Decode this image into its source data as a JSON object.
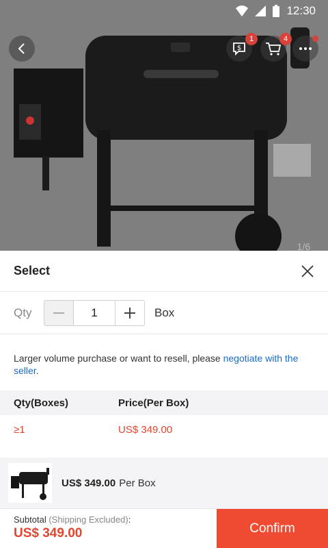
{
  "status_bar": {
    "time": "12:30"
  },
  "header": {
    "message_badge": "1",
    "cart_badge": "4",
    "photo_counter": "1/6"
  },
  "sheet": {
    "title": "Select",
    "qty_label": "Qty",
    "qty_value": "1",
    "qty_unit": "Box",
    "note_text": "Larger volume purchase or want to resell, please ",
    "note_link": "negotiate with the seller",
    "note_end": ".",
    "table": {
      "col_qty": "Qty(Boxes)",
      "col_price": "Price(Per Box)",
      "rows": [
        {
          "qty": "≥1",
          "price": "US$ 349.00"
        }
      ]
    }
  },
  "summary": {
    "price": "US$ 349.00",
    "unit": "Per Box"
  },
  "footer": {
    "subtotal_label": "Subtotal",
    "subtotal_note": "(Shipping Excluded)",
    "subtotal_colon": ":",
    "subtotal_amount": "US$ 349.00",
    "confirm_label": "Confirm"
  },
  "colors": {
    "accent": "#ef4a32",
    "price": "#e3462f",
    "link": "#1a6bc4"
  }
}
